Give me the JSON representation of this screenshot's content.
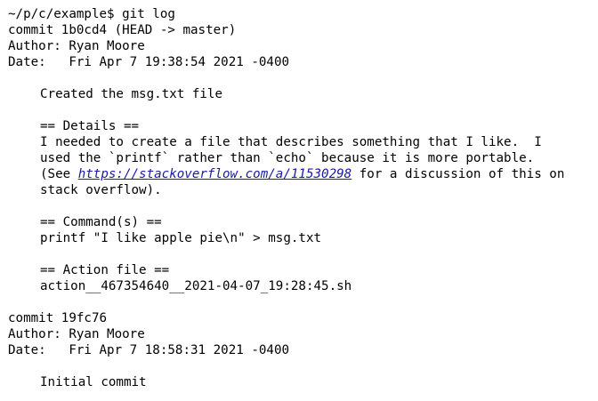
{
  "terminal": {
    "prompt": "~/p/c/example$ ",
    "command": "git log",
    "commits": [
      {
        "commit_line": "commit 1b0cd4 (HEAD -> master)",
        "author_line": "Author: Ryan Moore",
        "date_line": "Date:   Fri Apr 7 19:38:54 2021 -0400",
        "subject": "Created the msg.txt file",
        "details_header": "== Details ==",
        "details_line1": "I needed to create a file that describes something that I like.  I",
        "details_line2": "used the `printf` rather than `echo` because it is more portable.",
        "details_line3_pre": "(See ",
        "details_link": "https://stackoverflow.com/a/11530298",
        "details_line3_post": " for a discussion of this on",
        "details_line4": "stack overflow).",
        "commands_header": "== Command(s) ==",
        "command_text": "printf \"I like apple pie\\n\" > msg.txt",
        "action_header": "== Action file ==",
        "action_file": "action__467354640__2021-04-07_19:28:45.sh"
      },
      {
        "commit_line": "commit 19fc76",
        "author_line": "Author: Ryan Moore",
        "date_line": "Date:   Fri Apr 7 18:58:31 2021 -0400",
        "subject": "Initial commit"
      }
    ]
  }
}
